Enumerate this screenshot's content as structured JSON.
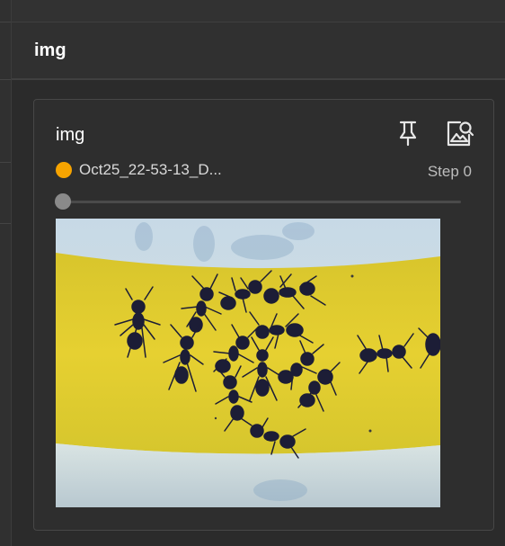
{
  "section": {
    "title": "img"
  },
  "card": {
    "title": "img",
    "run_name": "Oct25_22-53-13_D...",
    "run_color": "#f7a400",
    "step_label": "Step 0",
    "step_value": 0,
    "icons": {
      "pin": "pin-icon",
      "inspect": "image-search-icon"
    },
    "image": {
      "subject": "ant-photo"
    }
  }
}
